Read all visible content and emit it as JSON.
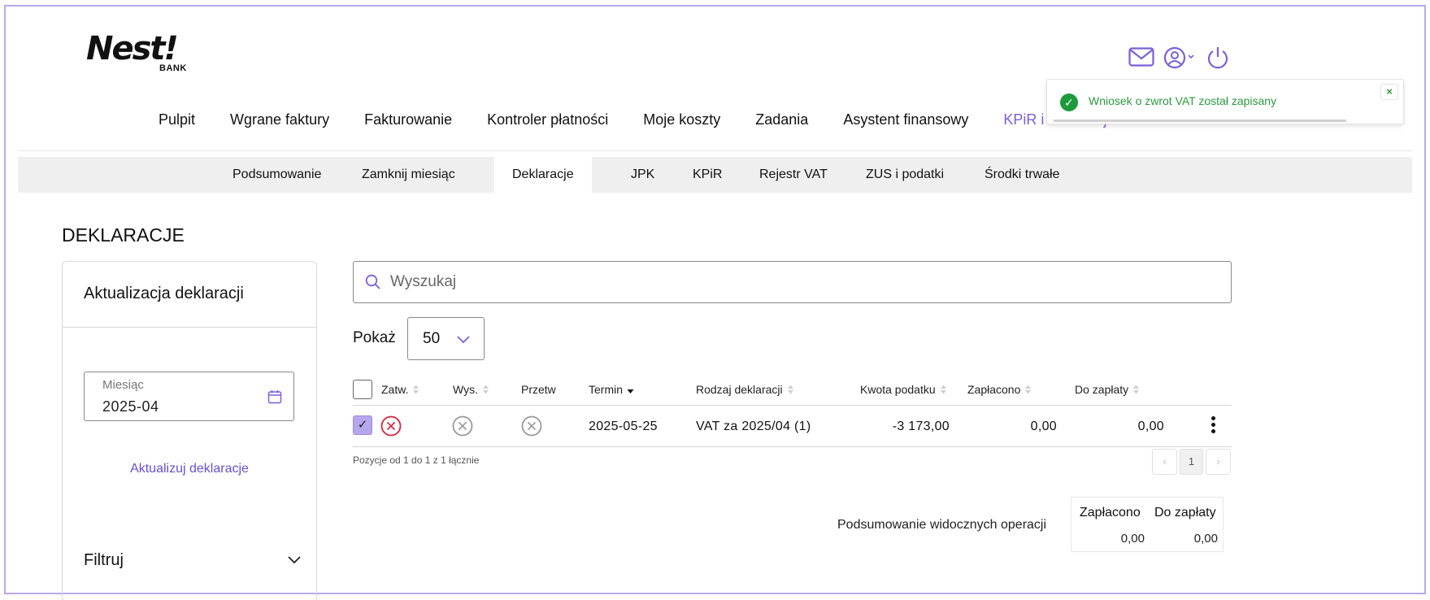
{
  "logo": {
    "main": "Nest!",
    "sub": "BANK"
  },
  "top_icons": [
    "mail-icon",
    "user-icon",
    "power-icon"
  ],
  "main_nav": [
    {
      "label": "Pulpit"
    },
    {
      "label": "Wgrane faktury"
    },
    {
      "label": "Fakturowanie"
    },
    {
      "label": "Kontroler płatności"
    },
    {
      "label": "Moje koszty"
    },
    {
      "label": "Zadania"
    },
    {
      "label": "Asystent finansowy"
    },
    {
      "label": "KPiR i deklaracje",
      "active": true
    }
  ],
  "sub_nav": [
    {
      "label": "Podsumowanie"
    },
    {
      "label": "Zamknij miesiąc"
    },
    {
      "label": "Deklaracje",
      "active": true
    },
    {
      "label": "JPK"
    },
    {
      "label": "KPiR"
    },
    {
      "label": "Rejestr VAT"
    },
    {
      "label": "ZUS i podatki"
    },
    {
      "label": "Środki trwałe"
    }
  ],
  "toast": {
    "message": "Wniosek o zwrot VAT został zapisany",
    "close": "×",
    "color": "#2c9a40"
  },
  "page_title": "DEKLARACJE",
  "left_panel": {
    "title": "Aktualizacja deklaracji",
    "month_label": "Miesiąc",
    "month_value": "2025-04",
    "update_link": "Aktualizuj deklaracje",
    "filter_title": "Filtruj"
  },
  "search": {
    "placeholder": "Wyszukaj"
  },
  "show": {
    "label": "Pokaż",
    "value": "50"
  },
  "table": {
    "columns": [
      "Zatw.",
      "Wys.",
      "Przetw",
      "Termin",
      "Rodzaj deklaracji",
      "Kwota podatku",
      "Zapłacono",
      "Do zapłaty"
    ],
    "rows": [
      {
        "selected": true,
        "zatw": "rejected",
        "wys": "not-sent",
        "przetw": "not-processed",
        "termin": "2025-05-25",
        "rodzaj": "VAT za 2025/04 (1)",
        "kwota": "-3 173,00",
        "zaplacono": "0,00",
        "do_zaplaty": "0,00"
      }
    ],
    "info": "Pozycje od 1 do 1 z 1 łącznie",
    "pager": {
      "prev": "‹",
      "page": "1",
      "next": "›"
    }
  },
  "summary": {
    "label": "Podsumowanie widocznych operacji",
    "headers": [
      "Zapłacono",
      "Do zapłaty"
    ],
    "values": [
      "0,00",
      "0,00"
    ]
  },
  "colors": {
    "accent": "#7b5fd6",
    "error": "#d0253b",
    "success": "#1d9a3c"
  }
}
